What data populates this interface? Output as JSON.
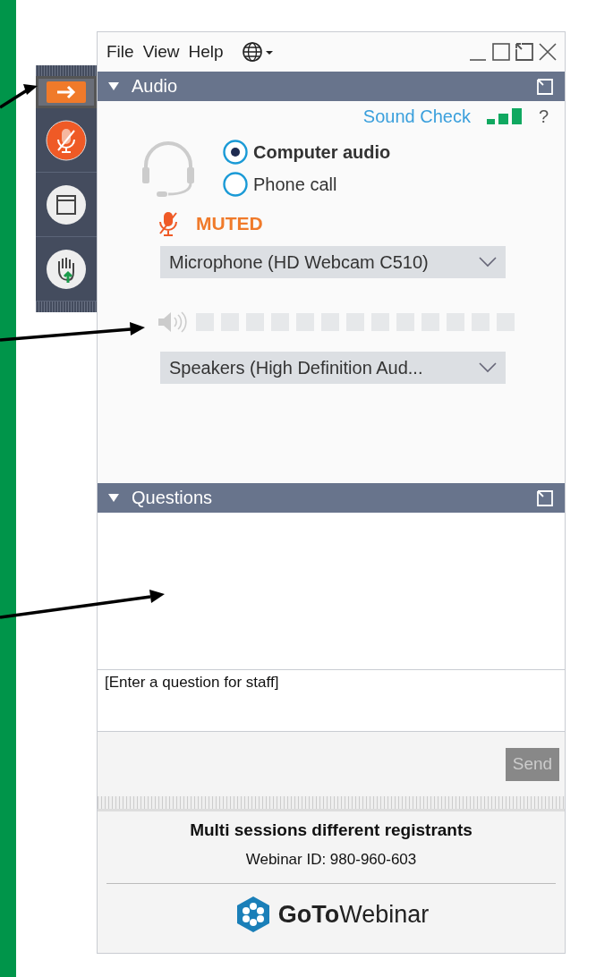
{
  "menu": [
    "File",
    "View",
    "Help"
  ],
  "side_panel": {
    "buttons": [
      {
        "kind": "arrow",
        "active": true
      },
      {
        "kind": "mic"
      },
      {
        "kind": "window"
      },
      {
        "kind": "hand"
      }
    ]
  },
  "audio": {
    "title": "Audio",
    "expanded": true,
    "sound_check": "Sound Check",
    "help": "?",
    "options": [
      {
        "label": "Computer audio",
        "selected": true
      },
      {
        "label": "Phone call",
        "selected": false
      }
    ],
    "mic_status": {
      "label": "MUTED",
      "muted": true
    },
    "microphone": "Microphone (HD Webcam C510)",
    "speakers": "Speakers (High Definition Aud..."
  },
  "questions": {
    "title": "Questions",
    "expanded": true,
    "placeholder": "[Enter a question for staff]",
    "send": {
      "label": "Send",
      "disabled": true
    }
  },
  "footer": {
    "title": "Multi sessions different registrants",
    "webinar_id": "Webinar ID: 980-960-603",
    "logo": "**GoTo**Webinar"
  }
}
